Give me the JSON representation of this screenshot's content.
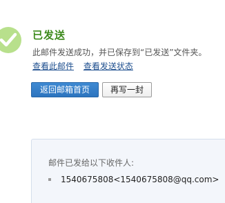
{
  "status": {
    "title": "已发送",
    "message": "此邮件发送成功，并已保存到“已发送”文件夹。",
    "icon": "check-circle-icon",
    "icon_color": "#b8e08c"
  },
  "links": {
    "view_mail": "查看此邮件",
    "view_status": "查看发送状态"
  },
  "buttons": {
    "back_to_inbox": "返回邮箱首页",
    "write_another": "再写一封"
  },
  "recipients": {
    "heading": "邮件已发给以下收件人:",
    "items": [
      "1540675808<1540675808@qq.com>"
    ]
  }
}
